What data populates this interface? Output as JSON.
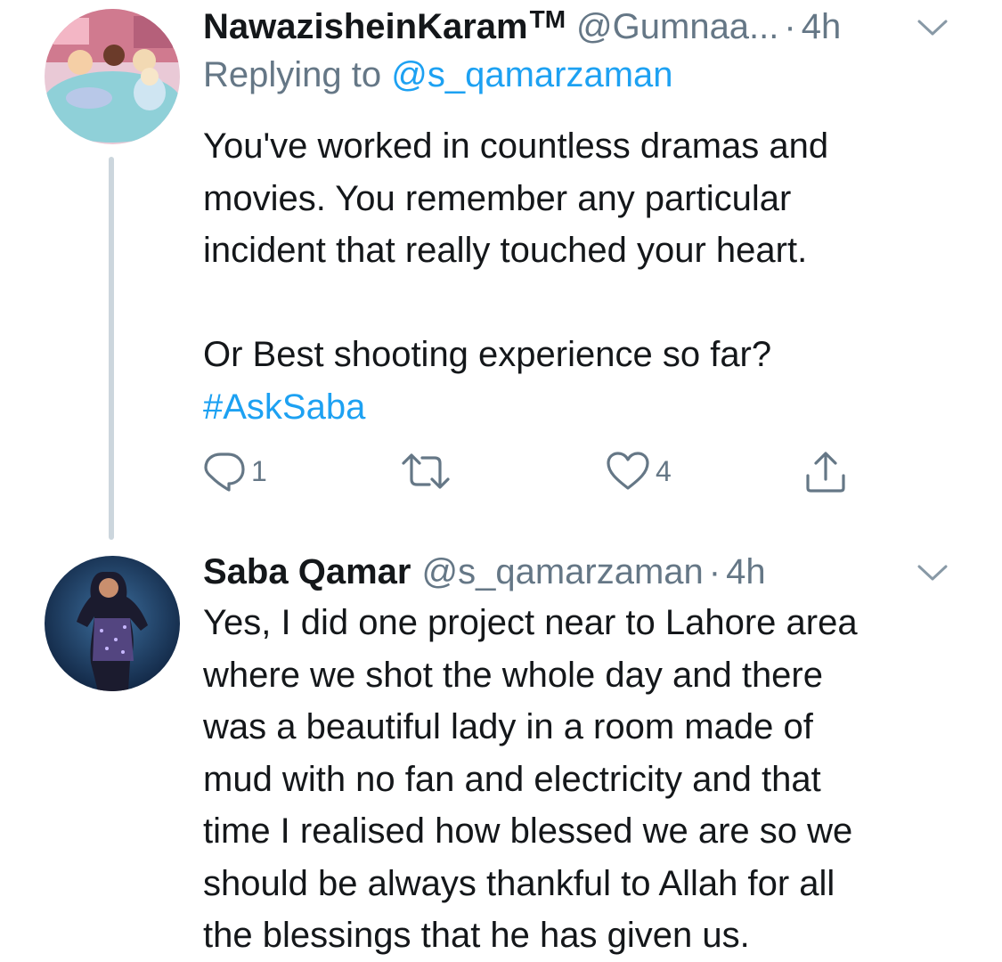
{
  "tweets": [
    {
      "display_name": "NawazisheinKaram",
      "display_name_suffix": "TM",
      "handle": "@Gumnaa...",
      "separator": "·",
      "time": "4h",
      "reply_prefix": "Replying to",
      "reply_to": "@s_qamarzaman",
      "body_lines": [
        "You've worked in countless dramas and",
        "movies. You remember any particular",
        "incident that really touched your heart.",
        "Or Best shooting experience so far?"
      ],
      "hashtag": "#AskSaba",
      "actions": {
        "reply_count": "1",
        "retweet_count": "",
        "like_count": "4"
      }
    },
    {
      "display_name": "Saba Qamar",
      "handle": "@s_qamarzaman",
      "separator": "·",
      "time": "4h",
      "body_lines": [
        "Yes, I did one project near to Lahore area",
        "where we shot the whole day and there",
        "was a beautiful lady in a room made of",
        "mud with no fan and electricity and that",
        "time I realised how blessed we are so we",
        "should be always thankful to Allah for all",
        "the blessings that he has given us."
      ]
    }
  ],
  "colors": {
    "text": "#14171a",
    "secondary": "#657786",
    "link": "#1da1f2",
    "thread_line": "#ccd6dd"
  },
  "icons": [
    "reply-icon",
    "retweet-icon",
    "like-icon",
    "share-icon",
    "chevron-down-icon"
  ]
}
